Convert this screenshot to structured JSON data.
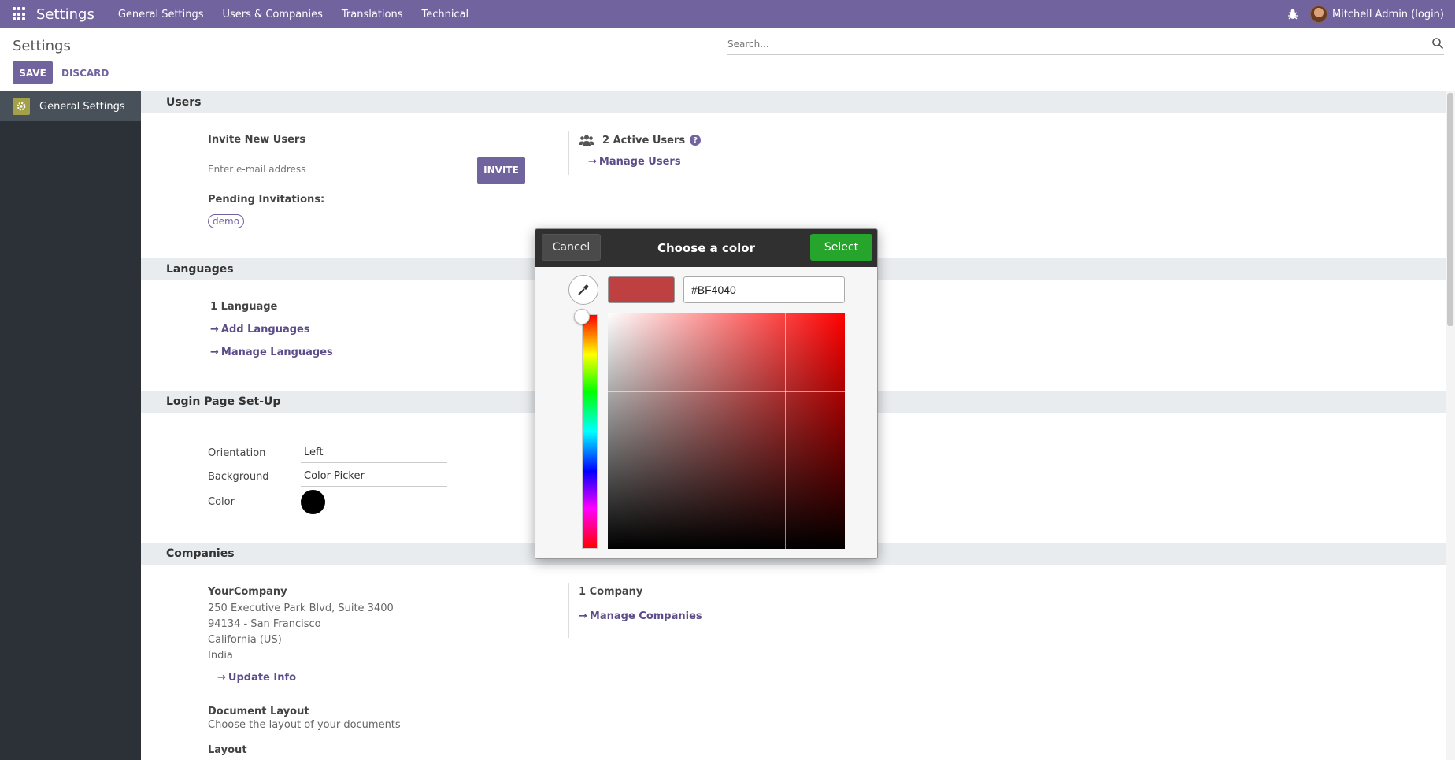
{
  "navbar": {
    "brand": "Settings",
    "menu": [
      "General Settings",
      "Users & Companies",
      "Translations",
      "Technical"
    ],
    "user": "Mitchell Admin (login)"
  },
  "control_panel": {
    "title": "Settings",
    "save_label": "SAVE",
    "discard_label": "DISCARD",
    "search_placeholder": "Search..."
  },
  "sidebar": {
    "items": [
      {
        "label": "General Settings",
        "icon": "gear-icon"
      }
    ]
  },
  "users": {
    "heading": "Users",
    "invite_title": "Invite New Users",
    "email_placeholder": "Enter e-mail address",
    "invite_label": "INVITE",
    "pending_title": "Pending Invitations:",
    "pending": [
      "demo"
    ],
    "active_users": "2 Active Users",
    "help": "?",
    "manage_users": "Manage Users"
  },
  "languages": {
    "heading": "Languages",
    "count": "1 Language",
    "add": "Add Languages",
    "manage": "Manage Languages"
  },
  "login_page": {
    "heading": "Login Page Set-Up",
    "orientation_label": "Orientation",
    "orientation_value": "Left",
    "background_label": "Background",
    "background_value": "Color Picker",
    "color_label": "Color",
    "color_value": "#000000"
  },
  "companies": {
    "heading": "Companies",
    "name": "YourCompany",
    "address": [
      "250 Executive Park Blvd, Suite 3400",
      "94134 - San Francisco",
      "California (US)",
      "India"
    ],
    "update_info": "Update Info",
    "count": "1 Company",
    "manage": "Manage Companies",
    "doc_layout_title": "Document Layout",
    "doc_layout_desc": "Choose the layout of your documents",
    "layout_label": "Layout"
  },
  "color_dialog": {
    "title": "Choose a color",
    "cancel_label": "Cancel",
    "select_label": "Select",
    "hex_value": "#BF4040",
    "current_color": "#BF4040"
  },
  "colors": {
    "brand": "#71639e",
    "select_green": "#26a42c"
  }
}
